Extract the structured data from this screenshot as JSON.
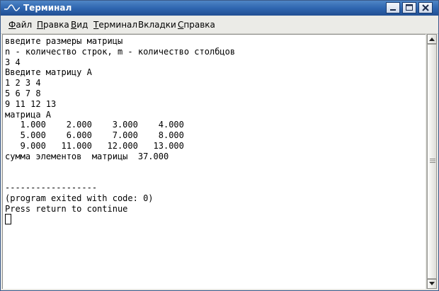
{
  "window": {
    "title": "Терминал",
    "app_icon": "terminal-wave-icon",
    "controls": {
      "minimize": "minimize-icon",
      "maximize": "maximize-icon",
      "close": "close-icon"
    }
  },
  "menu": {
    "items": [
      {
        "label_u": "Ф",
        "label_rest": "айл"
      },
      {
        "label_u": "П",
        "label_rest": "равка"
      },
      {
        "label_u": "В",
        "label_rest": "ид"
      },
      {
        "label_u": "Т",
        "label_rest": "ерминал"
      },
      {
        "label_u": "",
        "label_rest": "Вкладки"
      },
      {
        "label_u": "С",
        "label_rest": "правка"
      }
    ]
  },
  "terminal": {
    "lines": [
      "введите размеры матрицы",
      "n - количество строк, m - количество столбцов",
      "3 4",
      "Введите матрицу А",
      "1 2 3 4",
      "5 6 7 8",
      "9 11 12 13",
      "матрица А",
      "   1.000    2.000    3.000    4.000",
      "   5.000    6.000    7.000    8.000",
      "   9.000   11.000   12.000   13.000",
      "сумма элементов  матрицы  37.000",
      "",
      "",
      "------------------",
      "(program exited with code: 0)",
      "Press return to continue"
    ]
  },
  "scrollbar": {
    "up": "scroll-up-arrow-icon",
    "down": "scroll-down-arrow-icon",
    "thumb_fraction": 1.0
  },
  "colors": {
    "titlebar": "#2f66b0",
    "terminal_bg": "#ffffff",
    "terminal_fg": "#000000"
  }
}
